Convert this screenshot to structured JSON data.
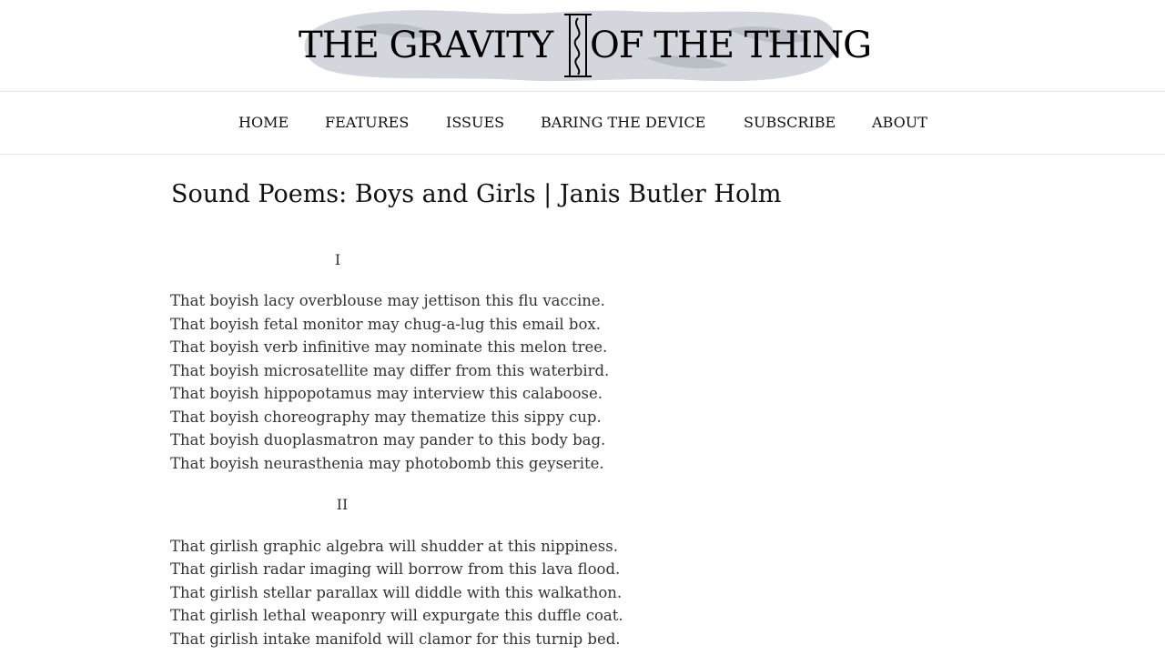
{
  "masthead": {
    "title_left": "THE GRAVITY",
    "title_right": "OF THE THING",
    "tagline": ""
  },
  "nav": {
    "items": [
      {
        "label": "HOME"
      },
      {
        "label": "FEATURES"
      },
      {
        "label": "ISSUES"
      },
      {
        "label": "BARING THE DEVICE"
      },
      {
        "label": "SUBSCRIBE"
      },
      {
        "label": "ABOUT"
      }
    ]
  },
  "post": {
    "title": "Sound Poems: Boys and Girls | Janis Butler Holm",
    "sections": [
      {
        "numeral": "I",
        "lines": [
          "That boyish lacy overblouse may jettison this flu vaccine.",
          "That boyish fetal monitor may chug-a-lug this email box.",
          "That boyish verb infinitive may nominate this melon tree.",
          "That boyish microsatellite may differ from this waterbird.",
          "That boyish hippopotamus may interview this calaboose.",
          "That boyish choreography may thematize this sippy cup.",
          "That boyish duoplasmatron may pander to this body bag.",
          "That boyish neurasthenia may photobomb this geyserite."
        ]
      },
      {
        "numeral": "II",
        "lines": [
          "That girlish graphic algebra will shudder at this nippiness.",
          "That girlish radar imaging will borrow from this lava flood.",
          "That girlish stellar parallax will diddle with this walkathon.",
          "That girlish lethal weaponry will expurgate this duffle coat.",
          "That girlish intake manifold will clamor for this turnip bed."
        ]
      }
    ]
  },
  "colors": {
    "text": "#333333",
    "rule": "#e6e6e6",
    "masthead_art": "#d3d6dc"
  }
}
